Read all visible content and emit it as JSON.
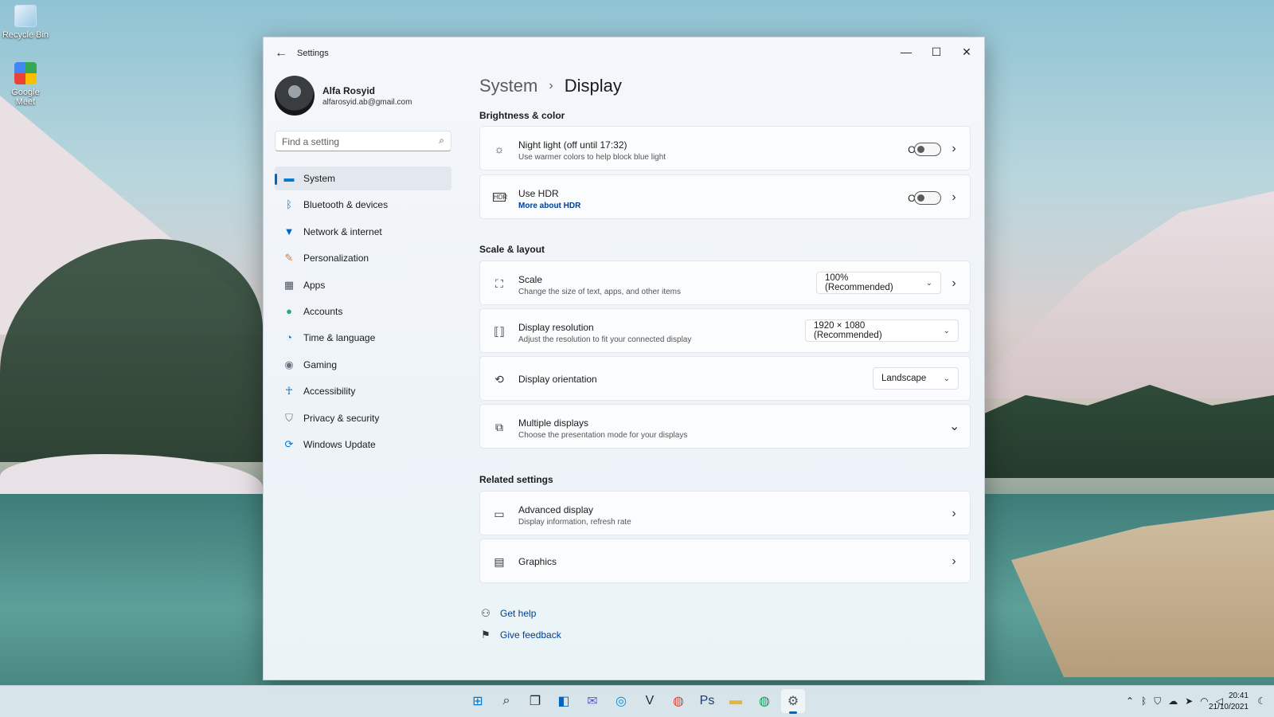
{
  "desktop": {
    "icons": [
      {
        "label": "Recycle Bin"
      },
      {
        "label": "Google Meet"
      }
    ]
  },
  "window": {
    "title": "Settings",
    "controls": {
      "minimize": "—",
      "maximize": "☐",
      "close": "✕"
    }
  },
  "profile": {
    "name": "Alfa Rosyid",
    "email": "alfarosyid.ab@gmail.com"
  },
  "search": {
    "placeholder": "Find a setting"
  },
  "nav": {
    "items": [
      {
        "label": "System",
        "icon": "monitor-icon",
        "glyph": "▬",
        "color": "#0078d4",
        "active": true
      },
      {
        "label": "Bluetooth & devices",
        "icon": "bluetooth-icon",
        "glyph": "ᛒ",
        "color": "#0078d4"
      },
      {
        "label": "Network & internet",
        "icon": "wifi-icon",
        "glyph": "▼",
        "color": "#0067c0"
      },
      {
        "label": "Personalization",
        "icon": "brush-icon",
        "glyph": "✎",
        "color": "#d9782b"
      },
      {
        "label": "Apps",
        "icon": "apps-icon",
        "glyph": "▦",
        "color": "#4b5563"
      },
      {
        "label": "Accounts",
        "icon": "person-icon",
        "glyph": "●",
        "color": "#2aa876"
      },
      {
        "label": "Time & language",
        "icon": "globe-icon",
        "glyph": "◔",
        "color": "#0078d4"
      },
      {
        "label": "Gaming",
        "icon": "gamepad-icon",
        "glyph": "◉",
        "color": "#6b7280"
      },
      {
        "label": "Accessibility",
        "icon": "accessibility-icon",
        "glyph": "☥",
        "color": "#0067c0"
      },
      {
        "label": "Privacy & security",
        "icon": "shield-icon",
        "glyph": "⛉",
        "color": "#6b7280"
      },
      {
        "label": "Windows Update",
        "icon": "update-icon",
        "glyph": "⟳",
        "color": "#0078d4"
      }
    ]
  },
  "breadcrumb": {
    "parent": "System",
    "separator": "›",
    "current": "Display"
  },
  "sections": {
    "brightness": "Brightness & color",
    "scale": "Scale & layout",
    "related": "Related settings"
  },
  "cards": {
    "night_light": {
      "title": "Night light (off until 17:32)",
      "subtitle": "Use warmer colors to help block blue light",
      "state": "Off",
      "icon": "sun-icon"
    },
    "hdr": {
      "title": "Use HDR",
      "link": "More about HDR",
      "state": "Off",
      "icon": "hdr-icon"
    },
    "scale": {
      "title": "Scale",
      "subtitle": "Change the size of text, apps, and other items",
      "value": "100% (Recommended)",
      "icon": "scale-icon"
    },
    "resolution": {
      "title": "Display resolution",
      "subtitle": "Adjust the resolution to fit your connected display",
      "value": "1920 × 1080 (Recommended)",
      "icon": "resolution-icon"
    },
    "orientation": {
      "title": "Display orientation",
      "value": "Landscape",
      "icon": "orientation-icon"
    },
    "multiple": {
      "title": "Multiple displays",
      "subtitle": "Choose the presentation mode for your displays",
      "icon": "multiple-displays-icon"
    },
    "advanced": {
      "title": "Advanced display",
      "subtitle": "Display information, refresh rate",
      "icon": "laptop-icon"
    },
    "graphics": {
      "title": "Graphics",
      "icon": "graphics-icon"
    }
  },
  "help": {
    "get_help": "Get help",
    "give_feedback": "Give feedback"
  },
  "taskbar": {
    "apps": [
      {
        "name": "start-icon",
        "glyph": "⊞",
        "color": "#0078d4"
      },
      {
        "name": "search-icon",
        "glyph": "⌕",
        "color": "#222"
      },
      {
        "name": "task-view-icon",
        "glyph": "❐",
        "color": "#222"
      },
      {
        "name": "widgets-icon",
        "glyph": "◧",
        "color": "#0067c0"
      },
      {
        "name": "teams-chat-icon",
        "glyph": "✉",
        "color": "#5b5fc7"
      },
      {
        "name": "edge-icon",
        "glyph": "◎",
        "color": "#0c8bd8"
      },
      {
        "name": "visual-studio-icon",
        "glyph": "V",
        "color": "#1a2a44"
      },
      {
        "name": "chrome-icon",
        "glyph": "◍",
        "color": "#db4437"
      },
      {
        "name": "photoshop-icon",
        "glyph": "Ps",
        "color": "#1f3b73"
      },
      {
        "name": "file-explorer-icon",
        "glyph": "▬",
        "color": "#e8b53c"
      },
      {
        "name": "chrome-profile-icon",
        "glyph": "◍",
        "color": "#0f9d58"
      },
      {
        "name": "settings-icon",
        "glyph": "⚙",
        "color": "#4b5563",
        "active": true
      }
    ],
    "tray_icons": [
      "chevron-up-icon",
      "bluetooth-icon",
      "defender-icon",
      "onedrive-icon",
      "location-icon",
      "wifi-icon",
      "volume-icon"
    ],
    "time": "20:41",
    "date": "21/10/2021"
  }
}
